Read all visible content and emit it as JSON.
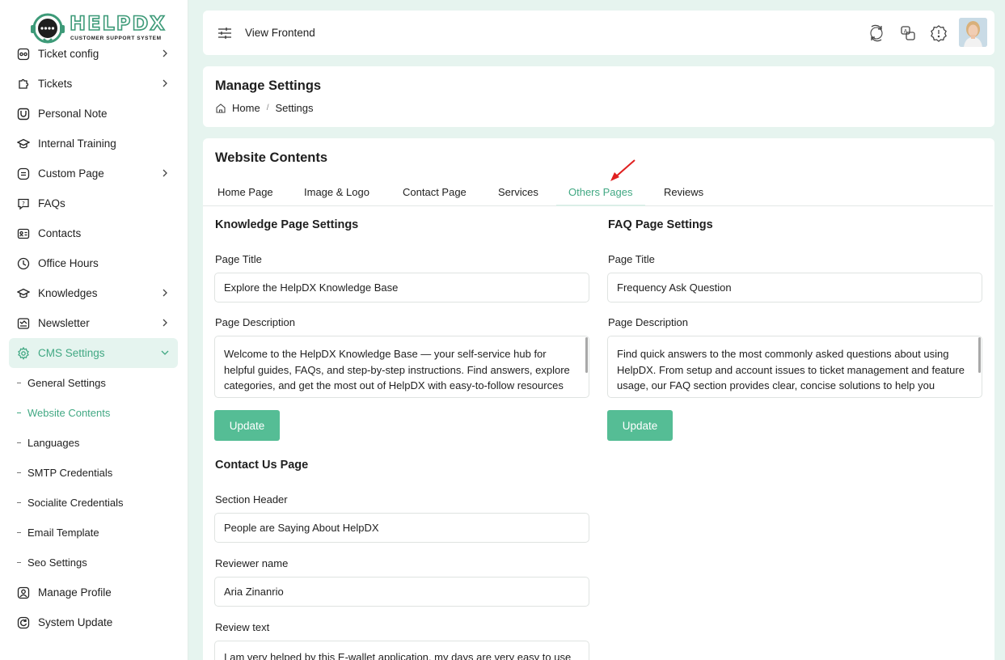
{
  "brand": {
    "name": "HELPDX",
    "tagline": "CUSTOMER SUPPORT SYSTEM"
  },
  "colors": {
    "accent": "#41a883",
    "button": "#55bd95",
    "background": "#e6f4ef"
  },
  "sidebar": {
    "items": [
      {
        "label": "Ticket config",
        "icon": "ticket-config-icon",
        "chevron": true
      },
      {
        "label": "Tickets",
        "icon": "puzzle-icon",
        "chevron": true
      },
      {
        "label": "Personal Note",
        "icon": "note-icon",
        "chevron": false
      },
      {
        "label": "Internal Training",
        "icon": "graduation-cap-icon",
        "chevron": false
      },
      {
        "label": "Custom Page",
        "icon": "page-icon",
        "chevron": true
      },
      {
        "label": "FAQs",
        "icon": "question-icon",
        "chevron": false
      },
      {
        "label": "Contacts",
        "icon": "contact-card-icon",
        "chevron": false
      },
      {
        "label": "Office Hours",
        "icon": "clock-icon",
        "chevron": false
      },
      {
        "label": "Knowledges",
        "icon": "book-icon",
        "chevron": true
      },
      {
        "label": "Newsletter",
        "icon": "newsletter-icon",
        "chevron": true
      },
      {
        "label": "CMS Settings",
        "icon": "gear-icon",
        "chevron": true,
        "active": true
      }
    ],
    "sub_items": [
      {
        "label": "General Settings"
      },
      {
        "label": "Website Contents",
        "active": true
      },
      {
        "label": "Languages"
      },
      {
        "label": "SMTP Credentials"
      },
      {
        "label": "Socialite Credentials"
      },
      {
        "label": "Email Template"
      },
      {
        "label": "Seo Settings"
      }
    ],
    "bottom_items": [
      {
        "label": "Manage Profile",
        "icon": "user-icon"
      },
      {
        "label": "System Update",
        "icon": "refresh-icon"
      }
    ]
  },
  "topbar": {
    "view_frontend": "View Frontend"
  },
  "header": {
    "title": "Manage Settings",
    "breadcrumb": {
      "home": "Home",
      "current": "Settings"
    }
  },
  "main": {
    "title": "Website Contents",
    "tabs": [
      {
        "label": "Home Page"
      },
      {
        "label": "Image & Logo"
      },
      {
        "label": "Contact Page"
      },
      {
        "label": "Services"
      },
      {
        "label": "Others Pages",
        "active": true
      },
      {
        "label": "Reviews"
      }
    ],
    "knowledge": {
      "title": "Knowledge Page Settings",
      "page_title_label": "Page Title",
      "page_title_value": "Explore the HelpDX Knowledge Base",
      "desc_label": "Page Description",
      "desc_value": "Welcome to the HelpDX Knowledge Base — your self-service hub for helpful guides, FAQs, and step-by-step instructions. Find answers, explore categories, and get the most out of HelpDX with easy-to-follow resources designed to support your team for any issue. From ticketing",
      "button": "Update"
    },
    "faq": {
      "title": "FAQ Page Settings",
      "page_title_label": "Page Title",
      "page_title_value": "Frequency Ask Question",
      "desc_label": "Page Description",
      "desc_value": "Find quick answers to the most commonly asked questions about using HelpDX. From setup and account issues to ticket management and feature usage, our FAQ section provides clear, concise solutions to help you resolve problems faster about helpdesk operations support.",
      "button": "Update"
    },
    "contact": {
      "title": "Contact Us Page",
      "section_header_label": "Section Header",
      "section_header_value": "People are Saying About HelpDX",
      "reviewer_label": "Reviewer name",
      "reviewer_value": "Aria Zinanrio",
      "review_label": "Review text",
      "review_value": "I am very helped by this E-wallet application, my days are very easy to use"
    }
  }
}
